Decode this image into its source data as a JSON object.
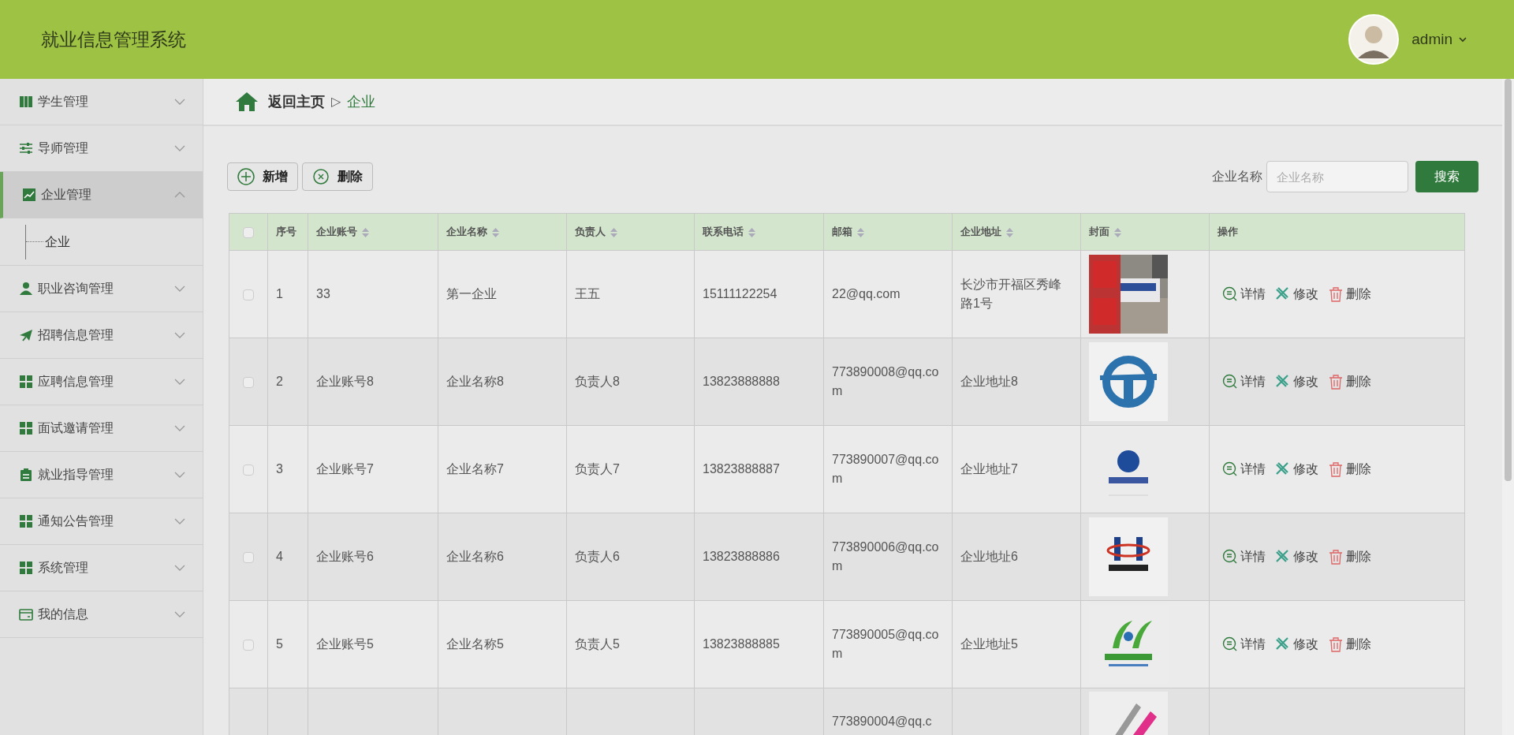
{
  "header": {
    "title": "就业信息管理系统",
    "user": "admin"
  },
  "sidebar": {
    "items": [
      {
        "label": "学生管理",
        "expanded": false
      },
      {
        "label": "导师管理",
        "expanded": false
      },
      {
        "label": "企业管理",
        "expanded": true,
        "children": [
          {
            "label": "企业"
          }
        ]
      },
      {
        "label": "职业咨询管理",
        "expanded": false
      },
      {
        "label": "招聘信息管理",
        "expanded": false
      },
      {
        "label": "应聘信息管理",
        "expanded": false
      },
      {
        "label": "面试邀请管理",
        "expanded": false
      },
      {
        "label": "就业指导管理",
        "expanded": false
      },
      {
        "label": "通知公告管理",
        "expanded": false
      },
      {
        "label": "系统管理",
        "expanded": false
      },
      {
        "label": "我的信息",
        "expanded": false
      }
    ]
  },
  "breadcrumb": {
    "home": "返回主页",
    "separator": "▷",
    "current": "企业"
  },
  "toolbar": {
    "buttons": [
      "新增",
      "删除"
    ],
    "search_label": "企业名称",
    "search_placeholder": "企业名称",
    "search_button": "搜索"
  },
  "table": {
    "columns": [
      "序号",
      "企业账号",
      "企业名称",
      "负责人",
      "联系电话",
      "邮箱",
      "企业地址",
      "封面",
      "操作"
    ],
    "header_checked": false,
    "rows": [
      {
        "checked": false,
        "cells": [
          "1",
          "33",
          "第一企业",
          "王五",
          "15111122254",
          "22@qq.com",
          "长沙市开福区秀峰路1号"
        ],
        "actions": [
          "详情",
          "修改",
          "删除"
        ]
      },
      {
        "checked": false,
        "cells": [
          "2",
          "企业账号8",
          "企业名称8",
          "负责人8",
          "13823888888",
          "773890008@qq.com",
          "企业地址8"
        ],
        "actions": [
          "详情",
          "修改",
          "删除"
        ]
      },
      {
        "checked": false,
        "cells": [
          "3",
          "企业账号7",
          "企业名称7",
          "负责人7",
          "13823888887",
          "773890007@qq.com",
          "企业地址7"
        ],
        "actions": [
          "详情",
          "修改",
          "删除"
        ]
      },
      {
        "checked": false,
        "cells": [
          "4",
          "企业账号6",
          "企业名称6",
          "负责人6",
          "13823888886",
          "773890006@qq.com",
          "企业地址6"
        ],
        "actions": [
          "详情",
          "修改",
          "删除"
        ]
      },
      {
        "checked": false,
        "cells": [
          "5",
          "企业账号5",
          "企业名称5",
          "负责人5",
          "13823888885",
          "773890005@qq.com",
          "企业地址5"
        ],
        "actions": [
          "详情",
          "修改",
          "删除"
        ]
      }
    ],
    "partial_row": {
      "email": "773890004@qq.c"
    }
  }
}
